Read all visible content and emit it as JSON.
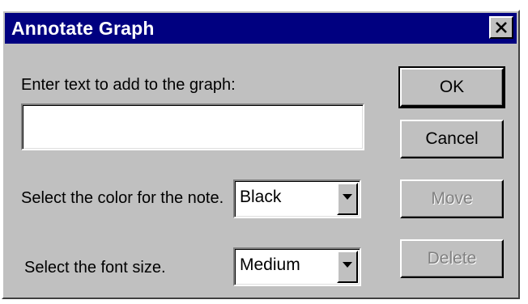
{
  "window": {
    "title": "Annotate Graph",
    "close_icon": "close-icon"
  },
  "form": {
    "text_label": "Enter text to add to the graph:",
    "text_value": "",
    "color_label": "Select the color for the note.",
    "color_value": "Black",
    "font_label": "Select the font size.",
    "font_value": "Medium"
  },
  "buttons": {
    "ok": "OK",
    "cancel": "Cancel",
    "move": "Move",
    "delete": "Delete"
  },
  "colors": {
    "titlebar": "#000080",
    "dialog_face": "#c0c0c0",
    "disabled_text": "#808080"
  }
}
